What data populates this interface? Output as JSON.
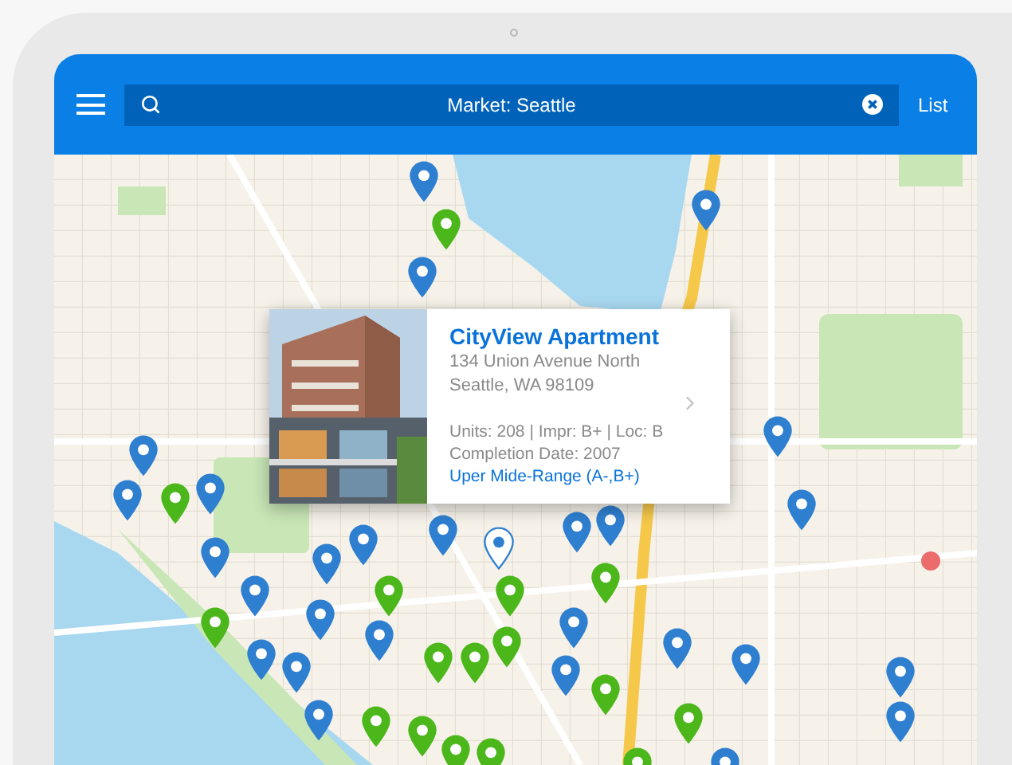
{
  "header": {
    "search": {
      "value": "Market: Seattle"
    },
    "list_button": "List"
  },
  "map": {
    "kind": "picture",
    "pins": [
      {
        "color": "#2f7fd0",
        "selected": false
      },
      {
        "color": "#2f7fd0",
        "selected": false
      },
      {
        "color": "#2f7fd0",
        "selected": false
      },
      {
        "color": "#2f7fd0",
        "selected": false
      },
      {
        "color": "#2f7fd0",
        "selected": false
      },
      {
        "color": "#2f7fd0",
        "selected": false
      },
      {
        "color": "#2f7fd0",
        "selected": false
      },
      {
        "color": "#2f7fd0",
        "selected": false
      },
      {
        "color": "#2f7fd0",
        "selected": false
      },
      {
        "color": "#2f7fd0",
        "selected": false
      },
      {
        "color": "#2f7fd0",
        "selected": false
      },
      {
        "color": "#2f7fd0",
        "selected": false
      },
      {
        "color": "#2f7fd0",
        "selected": false
      },
      {
        "color": "#2f7fd0",
        "selected": false
      },
      {
        "color": "#2f7fd0",
        "selected": false
      },
      {
        "color": "#2f7fd0",
        "selected": false
      },
      {
        "color": "#2f7fd0",
        "selected": false
      },
      {
        "color": "#2f7fd0",
        "selected": false
      },
      {
        "color": "#2f7fd0",
        "selected": false
      },
      {
        "color": "#2f7fd0",
        "selected": false
      },
      {
        "color": "#2f7fd0",
        "selected": false
      },
      {
        "color": "#2f7fd0",
        "selected": false
      },
      {
        "color": "#2f7fd0",
        "selected": false
      },
      {
        "color": "#2f7fd0",
        "selected": false
      },
      {
        "color": "#2f7fd0",
        "selected": false
      },
      {
        "color": "#2f7fd0",
        "selected": false
      },
      {
        "color": "#4bb71b",
        "selected": false
      },
      {
        "color": "#4bb71b",
        "selected": false
      },
      {
        "color": "#4bb71b",
        "selected": false
      },
      {
        "color": "#4bb71b",
        "selected": false
      },
      {
        "color": "#4bb71b",
        "selected": false
      },
      {
        "color": "#4bb71b",
        "selected": false
      },
      {
        "color": "#4bb71b",
        "selected": false
      },
      {
        "color": "#4bb71b",
        "selected": false
      },
      {
        "color": "#4bb71b",
        "selected": false
      },
      {
        "color": "#4bb71b",
        "selected": false
      },
      {
        "color": "#4bb71b",
        "selected": false
      },
      {
        "color": "#4bb71b",
        "selected": false
      },
      {
        "color": "#4bb71b",
        "selected": false
      },
      {
        "color": "#4bb71b",
        "selected": false
      },
      {
        "color": "#4bb71b",
        "selected": false
      },
      {
        "color": "#4bb71b",
        "selected": false
      },
      {
        "color": "#2f7fd0",
        "selected": false
      },
      {
        "color": "#2f7fd0",
        "selected": true
      }
    ]
  },
  "popup": {
    "title": "CityView Apartment",
    "address_lines": [
      "134 Union Avenue North",
      "Seattle, WA 98109"
    ],
    "details": [
      "Units: 208 | Impr: B+ | Loc: B",
      "Completion Date: 2007"
    ],
    "price_class": "Uper Mide-Range (A-,B+)"
  }
}
